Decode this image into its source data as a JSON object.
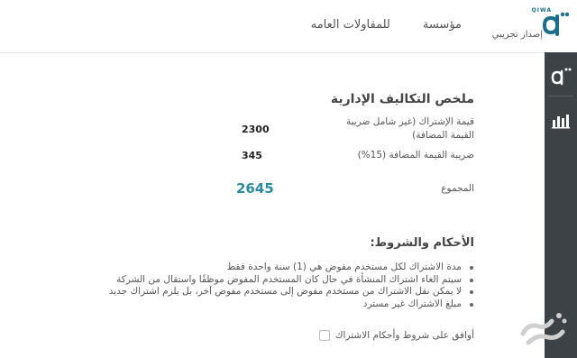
{
  "header": {
    "company_name_part1": "مؤسسة",
    "company_name_part2": "للمقاولات العامه",
    "brand_small": "QIWA",
    "beta_label": "إصدار تجريبي"
  },
  "sidebar": {
    "items": [
      {
        "icon": "qiwa-logo-icon"
      },
      {
        "icon": "bar-chart-icon"
      }
    ]
  },
  "summary": {
    "title": "ملخص التكاليف الإدارية",
    "rows": [
      {
        "label": "قيمة الإشتراك (غير شامل ضريبة القيمة المضافة)",
        "value": "2300"
      },
      {
        "label": "ضريبة القيمة المضافة (15%)",
        "value": "345"
      },
      {
        "label": "المجموع",
        "value": "2645"
      }
    ]
  },
  "terms": {
    "title": "الأحكام والشروط:",
    "items": [
      "مدة الاشتراك لكل مستخدم مفوض هي (1) سنة واحدة فقط",
      "سيتم الغاء اشتراك المنشأة في حال كان المستخدم المفوض موظفًا واستقال من الشركة",
      "لا يمكن نقل الاشتراك من مستخدم مفوض إلى مستخدم مفوض آخر، بل يلزم اشتراك جديد",
      "مبلغ الاشتراك غير مسترد"
    ]
  },
  "agreement": {
    "label": "أوافق على شروط وأحكام الاشتراك",
    "checked": false
  },
  "colors": {
    "sidebar_bg": "#3d4247",
    "total_accent": "#2a8ba0",
    "brand": "#1b6f8a"
  }
}
